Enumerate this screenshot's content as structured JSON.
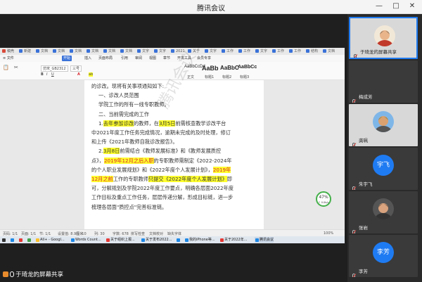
{
  "window": {
    "title": "腾讯会议",
    "controls": [
      "—",
      "□",
      "✕"
    ]
  },
  "wps": {
    "tabs": [
      {
        "label": "稿壳",
        "color": "#d84a3a"
      },
      {
        "label": "新建",
        "color": "#3a72d8"
      },
      {
        "label": "文档",
        "color": "#3a72d8"
      },
      {
        "label": "文档",
        "color": "#3a72d8"
      },
      {
        "label": "文档",
        "color": "#3a72d8"
      },
      {
        "label": "文档",
        "color": "#3a72d8"
      },
      {
        "label": "文档",
        "color": "#3a72d8"
      },
      {
        "label": "文档",
        "color": "#3a72d8"
      },
      {
        "label": "文字",
        "color": "#3a72d8"
      },
      {
        "label": "文字",
        "color": "#3a72d8"
      },
      {
        "label": "2021",
        "color": "#3a72d8"
      },
      {
        "label": "关于",
        "color": "#3a72d8"
      },
      {
        "label": "文字",
        "color": "#3a72d8"
      },
      {
        "label": "工作",
        "color": "#3a72d8"
      },
      {
        "label": "工作",
        "color": "#3a72d8"
      },
      {
        "label": "文字",
        "color": "#3a72d8"
      },
      {
        "label": "工作",
        "color": "#3a72d8"
      },
      {
        "label": "工作",
        "color": "#3a72d8"
      },
      {
        "label": "结构",
        "color": "#3a72d8"
      },
      {
        "label": "文档",
        "color": "#3a72d8"
      }
    ],
    "menu": [
      "≡ 文件",
      "开始",
      "插入",
      "页面布局",
      "引用",
      "审阅",
      "视图",
      "章节",
      "开发工具",
      "会员专享"
    ],
    "ribbon": {
      "font_name": "仿宋_GB2312",
      "font_size": "三号",
      "style_samples": [
        "AaBbCcDd",
        "AaBb",
        "AaBbC",
        "AaBbCc"
      ],
      "style_names": [
        "正文",
        "标题1",
        "标题2",
        "标题3"
      ]
    },
    "document_lines": [
      [
        {
          "t": "的诊改。现将有关事项通知如下:"
        }
      ],
      [
        {
          "t": "一、诊改人员范围"
        }
      ],
      [
        {
          "t": "学院工作的所有一线专职教师。"
        }
      ],
      [
        {
          "t": "二、当前需完成的工作"
        }
      ],
      [
        {
          "t": "1.",
          "hl": false
        },
        {
          "t": "去年参加诊改",
          "hl": true
        },
        {
          "t": "的教师，在"
        },
        {
          "t": "3月5日",
          "hl": true
        },
        {
          "t": "前需核查教学诊改平台"
        }
      ],
      [
        {
          "t": "中2021年度工作任务完成情况，逾期未完成的及时处理，修订"
        }
      ],
      [
        {
          "t": "和上传《2021年教师自我诊改报告》。"
        }
      ],
      [
        {
          "t": "2."
        },
        {
          "t": "3月8日",
          "hl": true
        },
        {
          "t": "前需结合《教师发展标准》和《教师发展质控"
        }
      ],
      [
        {
          "t": "点》，"
        },
        {
          "t": "2019年12月之后入职",
          "hl": true,
          "red": true
        },
        {
          "t": "的专职教师需制定《2022-2024年"
        }
      ],
      [
        {
          "t": "的个人职业发展规划》和《2022年度个人发展计划》，"
        },
        {
          "t": "2019年",
          "hl": true,
          "red": true
        }
      ],
      [
        {
          "t": "12月之前",
          "hl": true,
          "red": true
        },
        {
          "t": "工作的专职教师"
        },
        {
          "t": "只提交《2022年度个人发展计划》",
          "hl": true
        },
        {
          "t": "即"
        }
      ],
      [
        {
          "t": "可，分解规划及学院2022年度工作要点，明确各层面2022年度"
        }
      ],
      [
        {
          "t": "工作目标及重点工作任务，层层传递分解，形成目标链，进一步"
        }
      ],
      [
        {
          "t": "梳理各层面\"质控点\"完善标准链。"
        }
      ]
    ],
    "watermark": "腾讯会议 3190",
    "zoom_badge": "47%",
    "zoom_badge_sub": "↑ 0.0k/s",
    "status": [
      "页码: 1/1",
      "页面: 1/1",
      "节: 1/1",
      "设置值: 8.9厘米",
      "行: 10",
      "列: 30",
      "字数: 678",
      "拼写检查",
      "文档校对",
      "缺失字体"
    ],
    "status_right": "100%",
    "taskbar": [
      {
        "label": "",
        "color": "#333"
      },
      {
        "label": "",
        "color": "#1e88e5"
      },
      {
        "label": "",
        "color": "#e53935"
      },
      {
        "label": "",
        "color": "#43a047"
      },
      {
        "label": "All+ - Googl...",
        "color": "#fbc02d"
      },
      {
        "label": "Words Count...",
        "color": "#1e88e5"
      },
      {
        "label": "关于组织上报...",
        "color": "#e53935"
      },
      {
        "label": "关于发布2022...",
        "color": "#1e88e5"
      },
      {
        "label": "",
        "color": "#1e88e5"
      },
      {
        "label": "我的iPhone等...",
        "color": "#1e88e5"
      },
      {
        "label": "关于2022年...",
        "color": "#e53935"
      },
      {
        "label": "腾讯会议",
        "color": "#1e88e5"
      }
    ]
  },
  "share_label": "于琦龙的屏幕共享",
  "participants": [
    {
      "name": "于琦龙的屏幕共享",
      "kind": "photo",
      "active": true
    },
    {
      "name": "梅成芳",
      "kind": "blank"
    },
    {
      "name": "龚珮",
      "kind": "photo"
    },
    {
      "name": "朱宇飞",
      "kind": "initials",
      "initials": "宇飞"
    },
    {
      "name": "张岩",
      "kind": "photo"
    },
    {
      "name": "李芳",
      "kind": "initials",
      "initials": "李芳"
    }
  ]
}
